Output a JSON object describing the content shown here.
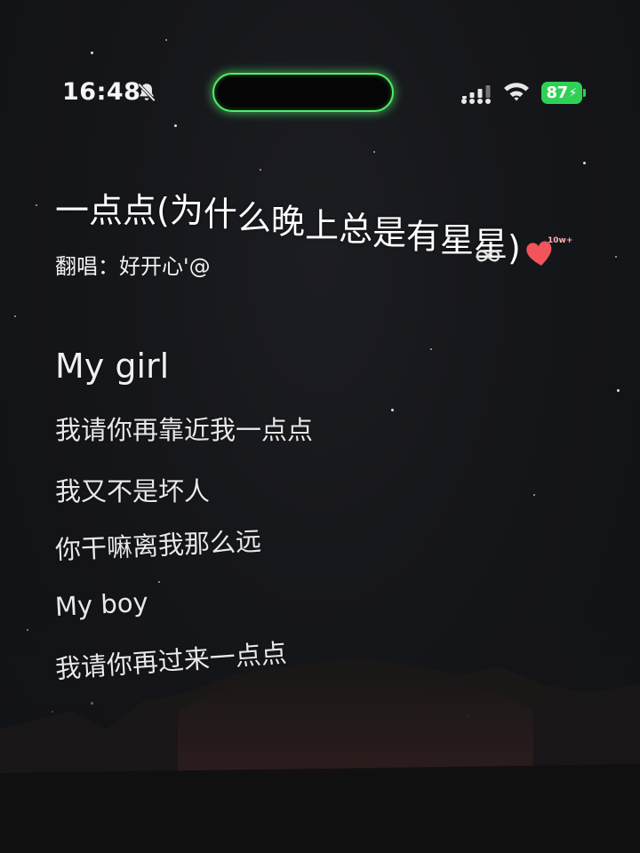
{
  "status_bar": {
    "time": "16:48",
    "battery": "87",
    "icons": [
      "bell-slash-icon",
      "signal-icon",
      "wifi-icon",
      "battery-icon"
    ],
    "accent_color": "#4ef06a",
    "battery_color": "#2fd155"
  },
  "song": {
    "title": "一点点(为什么晚上总是有星星)",
    "cover_artist": "翻唱：好开心'@",
    "like_count": "10w+",
    "heart_color": "#f2545b"
  },
  "lyrics": [
    "My girl",
    "我请你再靠近我一点点",
    "我又不是坏人",
    "你干嘛离我那么远",
    "My boy",
    "我请你再过来一点点"
  ]
}
